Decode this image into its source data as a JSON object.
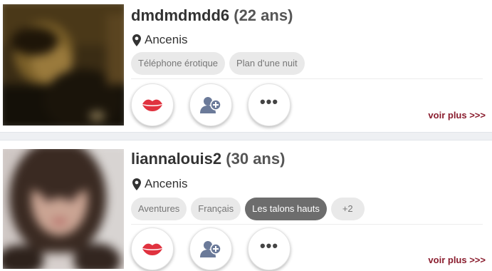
{
  "profiles": [
    {
      "username": "dmdmdmdd6",
      "age": "(22 ans)",
      "location": "Ancenis",
      "tags": [
        "Téléphone érotique",
        "Plan d'une nuit"
      ],
      "more_link": "voir plus >>>"
    },
    {
      "username": "liannalouis2",
      "age": "(30 ans)",
      "location": "Ancenis",
      "tags": [
        "Aventures",
        "Français",
        "Les talons hauts"
      ],
      "extra_tags": "+2",
      "more_link": "voir plus >>>"
    }
  ],
  "actions": {
    "more_label": "•••"
  },
  "colors": {
    "accent": "#8a1d2e",
    "kiss": "#e0323f",
    "add_user": "#6b7a99",
    "active_tag": "#6d6d6d"
  }
}
